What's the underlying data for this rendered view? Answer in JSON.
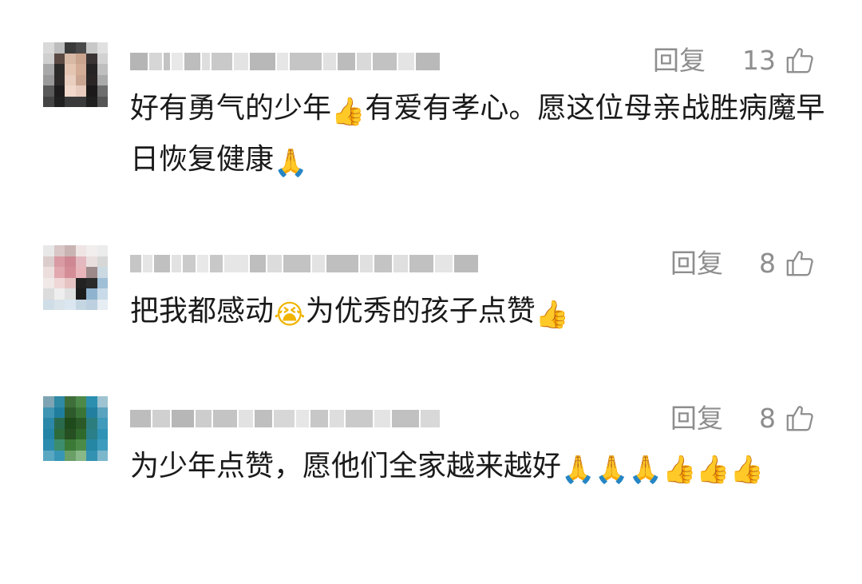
{
  "colors": {
    "meta_text": "#8e8e8e",
    "body_text": "#1a1a1a",
    "background": "#ffffff"
  },
  "comments": [
    {
      "reply_label": "回复",
      "like_count": "13",
      "like_icon": "thumbs-up-outline-icon",
      "text_segments": [
        "好有勇气的少年",
        "👍",
        "有爱有孝心。愿这位母亲战胜病魔早日恢复健康",
        "🙏"
      ]
    },
    {
      "reply_label": "回复",
      "like_count": "8",
      "like_icon": "thumbs-up-outline-icon",
      "text_segments": [
        "把我都感动",
        "😭",
        "为优秀的孩子点赞",
        "👍"
      ]
    },
    {
      "reply_label": "回复",
      "like_count": "8",
      "like_icon": "thumbs-up-outline-icon",
      "text_segments": [
        "为少年点赞，愿他们全家越来越好",
        "🙏",
        "🙏",
        "🙏",
        "👍",
        "👍",
        "👍"
      ]
    }
  ]
}
